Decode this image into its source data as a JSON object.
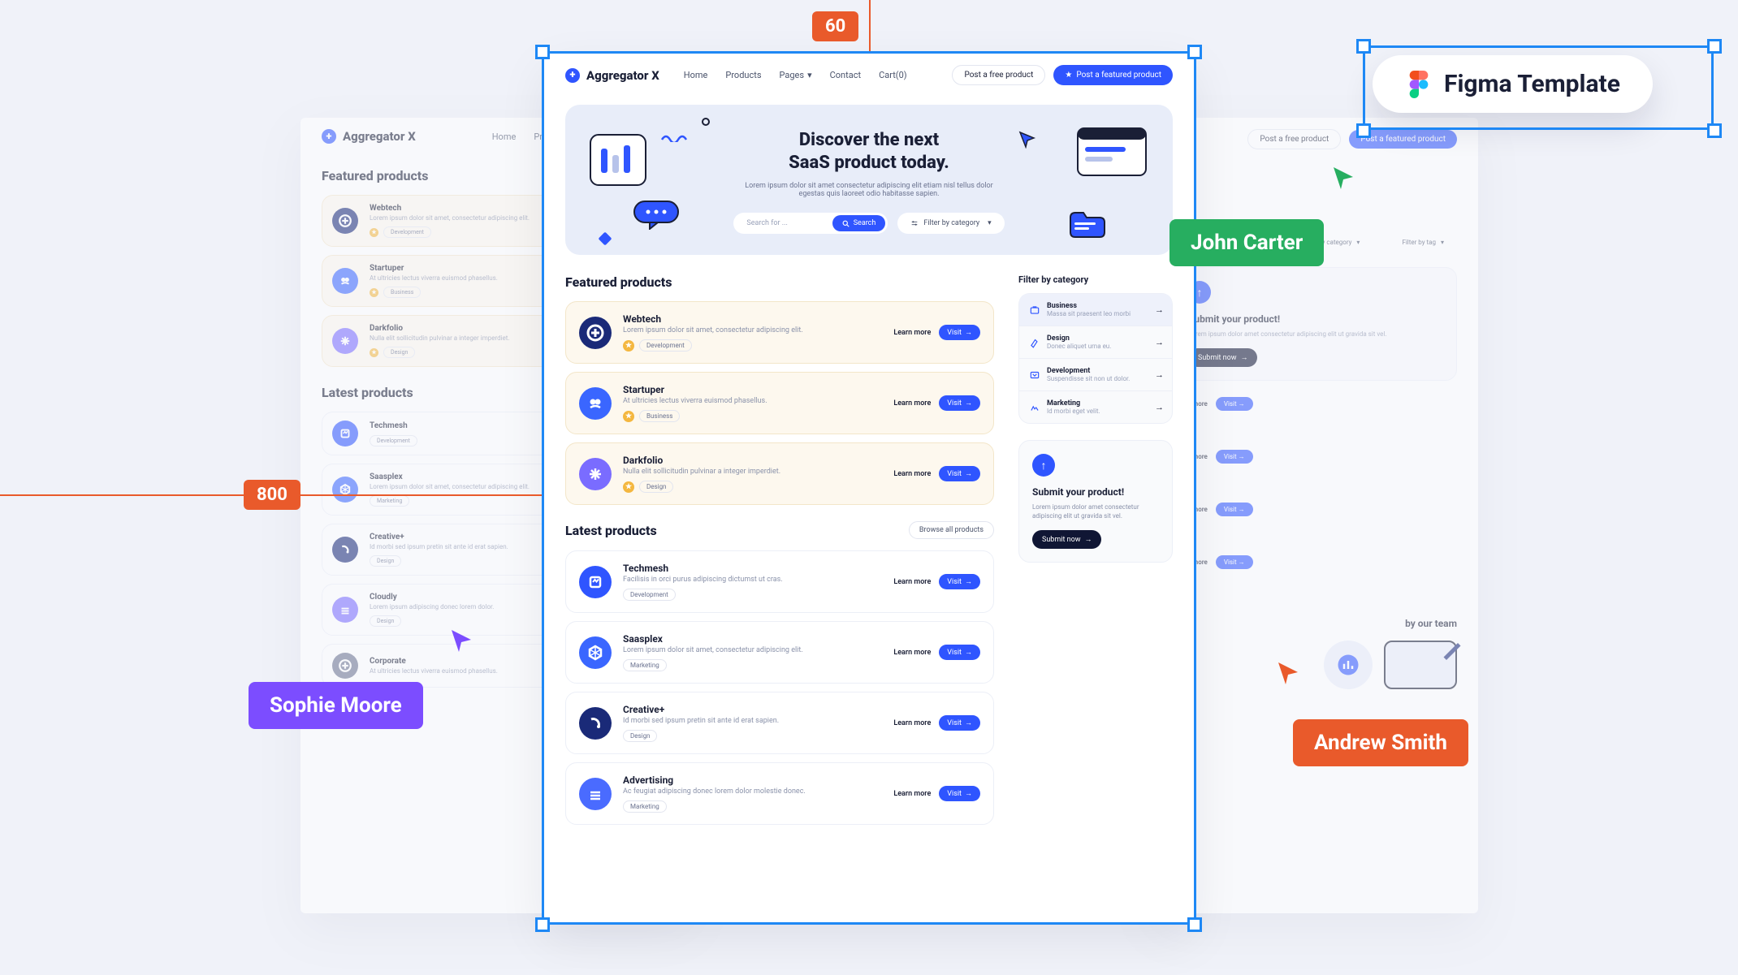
{
  "figma_pill": "Figma Template",
  "dim_top": "60",
  "dim_left": "800",
  "cursors": {
    "john": "John Carter",
    "sophie": "Sophie Moore",
    "andrew": "Andrew Smith"
  },
  "brand": "Aggregator X",
  "nav": {
    "home": "Home",
    "products": "Products",
    "pages": "Pages",
    "contact": "Contact",
    "cart": "Cart(0)"
  },
  "header_actions": {
    "post": "Post a free product",
    "featured": "Post a featured product"
  },
  "hero": {
    "title1": "Discover the next",
    "title2": "SaaS product today.",
    "sub": "Lorem ipsum dolor sit amet consectetur adipiscing elit etiam nisl tellus dolor egestas quis laoreet odio habitasse sapien.",
    "search_placeholder": "Search for ...",
    "search_btn": "Search",
    "filter_pill": "Filter by category"
  },
  "sections": {
    "featured": "Featured products",
    "latest": "Latest products",
    "browse": "Browse all products"
  },
  "featured": [
    {
      "name": "Webtech",
      "sub": "Lorem ipsum dolor sit amet, consectetur adipiscing elit.",
      "tag": "Development",
      "color": "#1a2a78"
    },
    {
      "name": "Startuper",
      "sub": "At ultricies lectus viverra euismod phasellus.",
      "tag": "Business",
      "color": "#3a66ff"
    },
    {
      "name": "Darkfolio",
      "sub": "Nulla elit sollicitudin pulvinar a integer imperdiet.",
      "tag": "Design",
      "color": "#7a6cff"
    }
  ],
  "latest": [
    {
      "name": "Techmesh",
      "sub": "Facilisis in orci purus adipiscing dictumst ut cras.",
      "tag": "Development",
      "color": "#2f55ff"
    },
    {
      "name": "Saasplex",
      "sub": "Lorem ipsum dolor sit amet, consectetur adipiscing elit.",
      "tag": "Marketing",
      "color": "#3a66ff"
    },
    {
      "name": "Creative+",
      "sub": "Id morbi sed ipsum pretin sit ante id erat sapien.",
      "tag": "Design",
      "color": "#1a2a78"
    },
    {
      "name": "Advertising",
      "sub": "Ac feugiat adipiscing donec lorem dolor molestie donec.",
      "tag": "Marketing",
      "color": "#4a6bff"
    }
  ],
  "card_actions": {
    "learn": "Learn more",
    "visit": "Visit"
  },
  "sidebar": {
    "title": "Filter by category",
    "cats": [
      {
        "name": "Business",
        "sub": "Massa sit praesent leo morbi"
      },
      {
        "name": "Design",
        "sub": "Donec aliquet urna eu."
      },
      {
        "name": "Development",
        "sub": "Suspendisse sit non ut dolor."
      },
      {
        "name": "Marketing",
        "sub": "Id morbi eget velit."
      }
    ],
    "submit": {
      "title": "Submit your product!",
      "sub": "Lorem ipsum dolor amet consectetur adipiscing elit ut gravida sit vel.",
      "btn": "Submit now"
    }
  },
  "bg_left": {
    "featured_title": "Featured products",
    "latest_title": "Latest products",
    "products": [
      {
        "name": "Webtech",
        "sub": "Lorem ipsum dolor sit amet, consectetur adipiscing elit.",
        "tag": "Development",
        "color": "#1a2a78"
      },
      {
        "name": "Startuper",
        "sub": "At ultricies lectus viverra euismod phasellus.",
        "tag": "Business",
        "color": "#3a66ff"
      },
      {
        "name": "Darkfolio",
        "sub": "Nulla elit sollicitudin pulvinar a integer imperdiet.",
        "tag": "Design",
        "color": "#7a6cff"
      }
    ],
    "latest": [
      {
        "name": "Techmesh",
        "sub": "",
        "tag": "Development",
        "color": "#2f55ff"
      },
      {
        "name": "Saasplex",
        "sub": "Lorem ipsum dolor sit amet, consectetur adipiscing elit.",
        "tag": "Marketing",
        "color": "#3a66ff"
      },
      {
        "name": "Creative+",
        "sub": "Id morbi sed ipsum pretin sit ante id erat sapien.",
        "tag": "Design",
        "color": "#1a2a78"
      },
      {
        "name": "Cloudly",
        "sub": "Lorem ipsum adipiscing donec lorem dolor.",
        "tag": "Design",
        "color": "#7a6cff"
      },
      {
        "name": "Corporate",
        "sub": "At ultricies lectus viverra euismod phasellus.",
        "tag": "",
        "color": "#6b7390"
      }
    ]
  },
  "bg_right": {
    "post": "Post a free product",
    "filter_cat": "Filter by category",
    "filter_tag": "Filter by tag",
    "submit_title": "Submit your product!",
    "submit_sub": "Lorem ipsum dolor amet consectetur adipiscing elit ut gravida sit vel.",
    "submit_btn": "Submit now",
    "team": "by our team",
    "learn": "Learn more",
    "visit": "Visit"
  }
}
